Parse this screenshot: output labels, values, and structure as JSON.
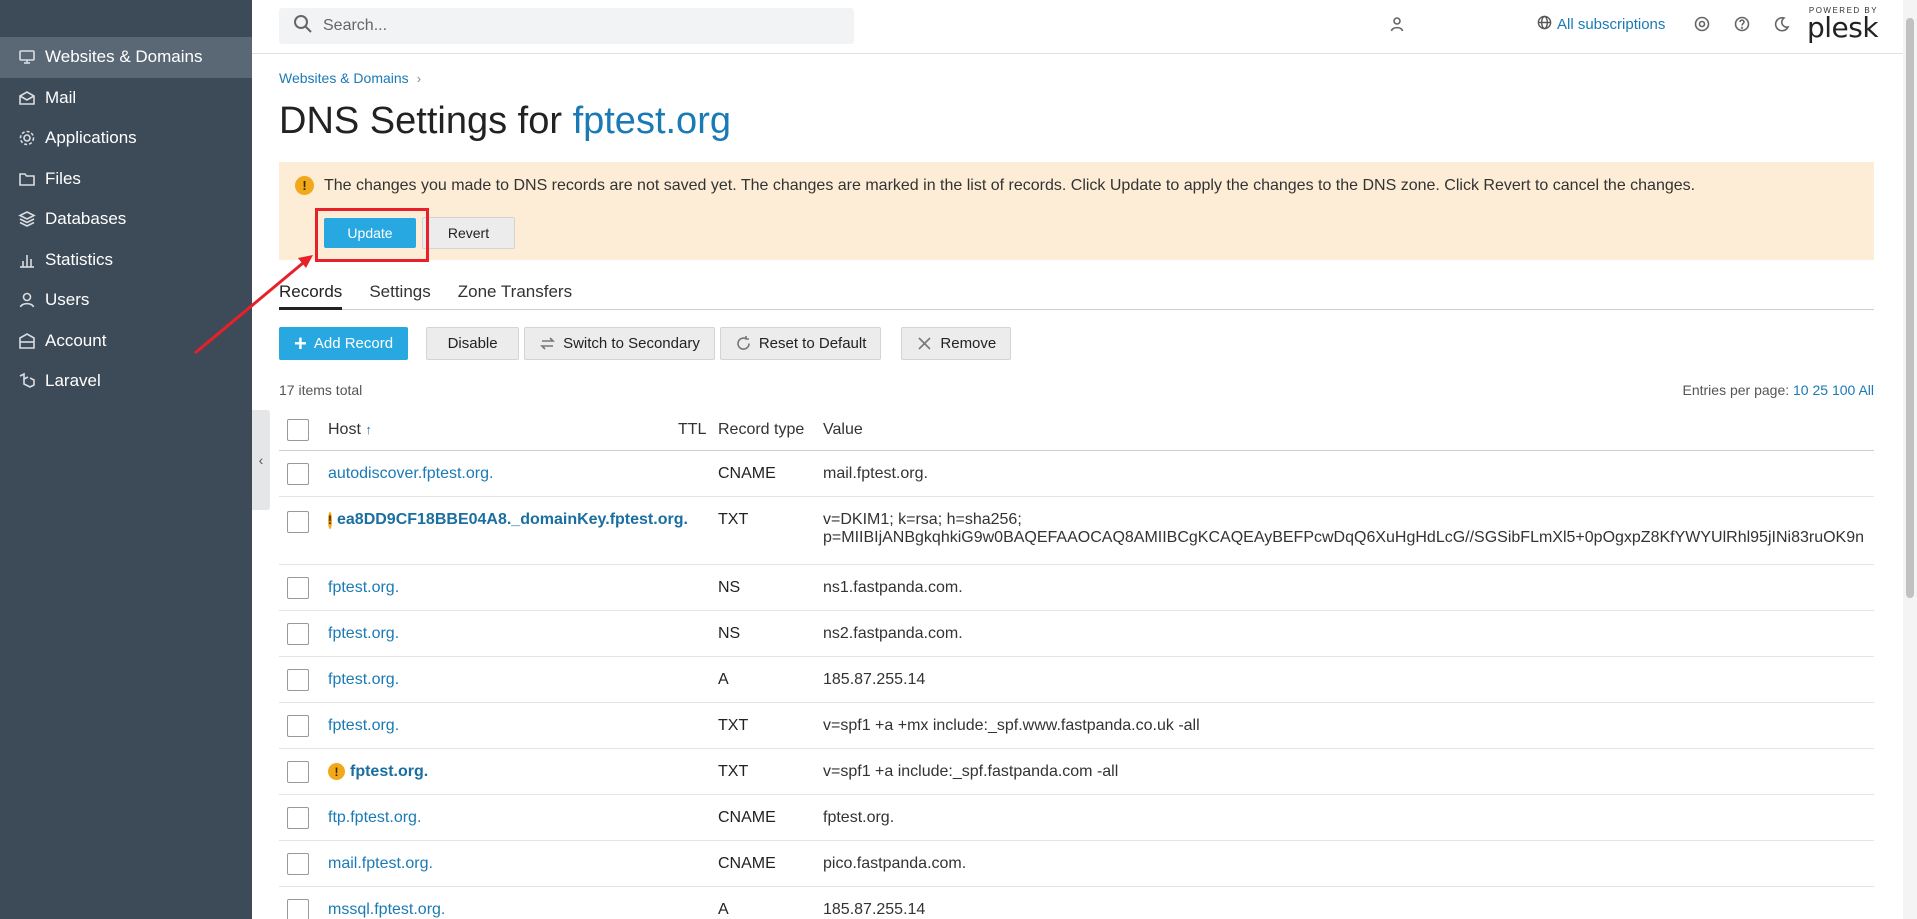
{
  "sidebar": {
    "items": [
      {
        "label": "Websites & Domains",
        "icon": "monitor-icon"
      },
      {
        "label": "Mail",
        "icon": "mail-icon"
      },
      {
        "label": "Applications",
        "icon": "gear-icon"
      },
      {
        "label": "Files",
        "icon": "folder-icon"
      },
      {
        "label": "Databases",
        "icon": "database-icon"
      },
      {
        "label": "Statistics",
        "icon": "bar-chart-icon"
      },
      {
        "label": "Users",
        "icon": "user-icon"
      },
      {
        "label": "Account",
        "icon": "account-icon"
      },
      {
        "label": "Laravel",
        "icon": "laravel-icon"
      }
    ],
    "collapse_glyph": "‹"
  },
  "topbar": {
    "search_placeholder": "Search...",
    "subscriptions_label": "All subscriptions",
    "logo_powered": "POWERED BY",
    "logo_name": "plesk"
  },
  "breadcrumb": {
    "item": "Websites & Domains",
    "sep": "›"
  },
  "page": {
    "title_prefix": "DNS Settings for ",
    "domain": "fptest.org"
  },
  "warning": {
    "icon_glyph": "!",
    "text": "The changes you made to DNS records are not saved yet. The changes are marked in the list of records. Click Update to apply the changes to the DNS zone. Click Revert to cancel the changes.",
    "update_label": "Update",
    "revert_label": "Revert"
  },
  "tabs": [
    {
      "label": "Records",
      "active": true
    },
    {
      "label": "Settings",
      "active": false
    },
    {
      "label": "Zone Transfers",
      "active": false
    }
  ],
  "toolbar": {
    "add_label": "Add Record",
    "add_glyph": "+",
    "disable_label": "Disable",
    "switch_label": "Switch to Secondary",
    "reset_label": "Reset to Default",
    "remove_label": "Remove"
  },
  "meta": {
    "total": "17 items total",
    "per_page_label": "Entries per page:",
    "per_page_options": [
      "10",
      "25",
      "100",
      "All"
    ]
  },
  "table": {
    "headers": {
      "host": "Host",
      "sort": "↑",
      "ttl": "TTL",
      "type": "Record type",
      "value": "Value"
    },
    "rows": [
      {
        "host": "autodiscover.fptest.org.",
        "ttl": "",
        "type": "CNAME",
        "value": "mail.fptest.org.",
        "changed": false
      },
      {
        "host": "ea8DD9CF18BBE04A8._domainKey.fptest.org.",
        "ttl": "",
        "type": "TXT",
        "value": "v=DKIM1; k=rsa; h=sha256;",
        "value2": "p=MIIBIjANBgkqhkiG9w0BAQEFAAOCAQ8AMIIBCgKCAQEAyBEFPcwDqQ6XuHgHdLcG//SGSibFLmXl5+0pOgxpZ8KfYWYUlRhl95jINi83ruOK9n",
        "changed": true
      },
      {
        "host": "fptest.org.",
        "ttl": "",
        "type": "NS",
        "value": "ns1.fastpanda.com.",
        "changed": false
      },
      {
        "host": "fptest.org.",
        "ttl": "",
        "type": "NS",
        "value": "ns2.fastpanda.com.",
        "changed": false
      },
      {
        "host": "fptest.org.",
        "ttl": "",
        "type": "A",
        "value": "185.87.255.14",
        "changed": false
      },
      {
        "host": "fptest.org.",
        "ttl": "",
        "type": "TXT",
        "value": "v=spf1 +a +mx include:_spf.www.fastpanda.co.uk -all",
        "changed": false
      },
      {
        "host": "fptest.org.",
        "ttl": "",
        "type": "TXT",
        "value": "v=spf1 +a include:_spf.fastpanda.com -all",
        "changed": true
      },
      {
        "host": "ftp.fptest.org.",
        "ttl": "",
        "type": "CNAME",
        "value": "fptest.org.",
        "changed": false
      },
      {
        "host": "mail.fptest.org.",
        "ttl": "",
        "type": "CNAME",
        "value": "pico.fastpanda.com.",
        "changed": false
      },
      {
        "host": "mssql.fptest.org.",
        "ttl": "",
        "type": "A",
        "value": "185.87.255.14",
        "changed": false
      }
    ]
  },
  "colors": {
    "accent": "#1a7ab5",
    "primary_button": "#28a8e0",
    "warning_bg": "#fdecd6",
    "highlight": "#e8202a",
    "sidebar": "#3d4a57"
  }
}
